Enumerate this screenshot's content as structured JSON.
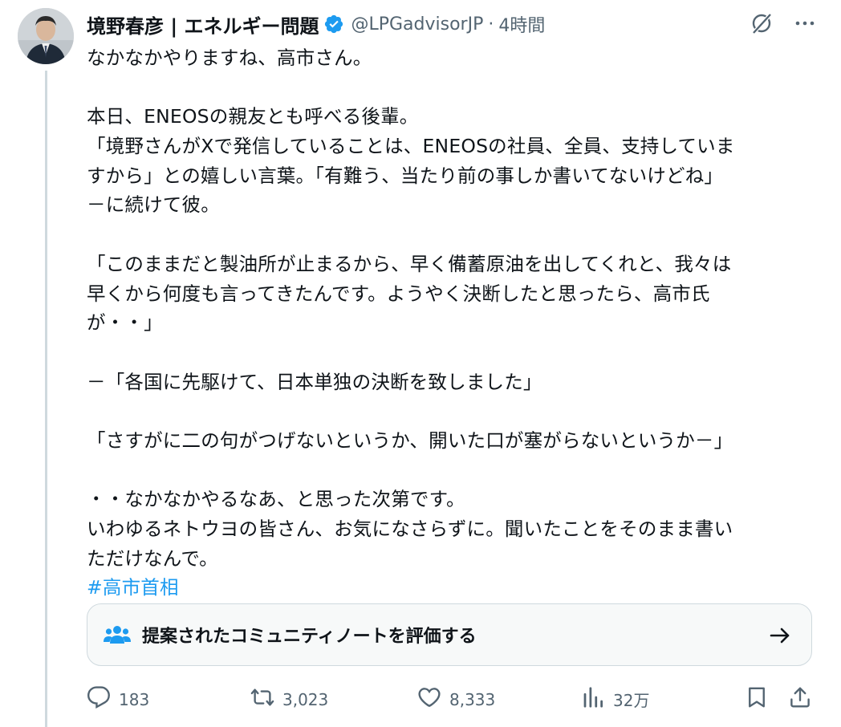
{
  "author": {
    "name": "境野春彦 | エネルギー問題",
    "handle": "@LPGadvisorJP",
    "separator": "·",
    "time": "4時間",
    "verified": true,
    "verified_color": "#1d9bf0"
  },
  "tweet": {
    "lines": [
      "なかなかやりますね、高市さん。",
      "",
      "本日、ENEOSの親友とも呼べる後輩。",
      "「境野さんがXで発信していることは、ENEOSの社員、全員、支持していま",
      "すから」との嬉しい言葉。「有難う、当たり前の事しか書いてないけどね」",
      "－に続けて彼。",
      "",
      "「このままだと製油所が止まるから、早く備蓄原油を出してくれと、我々は",
      "早くから何度も言ってきたんです。ようやく決断したと思ったら、高市氏",
      "が・・」",
      "",
      "－「各国に先駆けて、日本単独の決断を致しました」",
      "",
      "「さすがに二の句がつげないというか、開いた口が塞がらないというか－」",
      "",
      "・・なかなかやるなあ、と思った次第です。",
      "いわゆるネトウヨの皆さん、お気になさらずに。聞いたことをそのまま書い",
      "ただけなんで。"
    ],
    "hashtag": "#高市首相",
    "link_color": "#1d9bf0"
  },
  "community_note": {
    "label": "提案されたコミュニティノートを評価する",
    "icon": "people-icon",
    "arrow_icon": "arrow-right-icon"
  },
  "actions": {
    "replies": "183",
    "reposts": "3,023",
    "likes": "8,333",
    "views": "32万"
  },
  "icons": {
    "grok": "grok-icon",
    "more": "more-icon",
    "reply": "reply-icon",
    "repost": "repost-icon",
    "like": "heart-icon",
    "views": "views-icon",
    "bookmark": "bookmark-icon",
    "share": "share-icon"
  }
}
